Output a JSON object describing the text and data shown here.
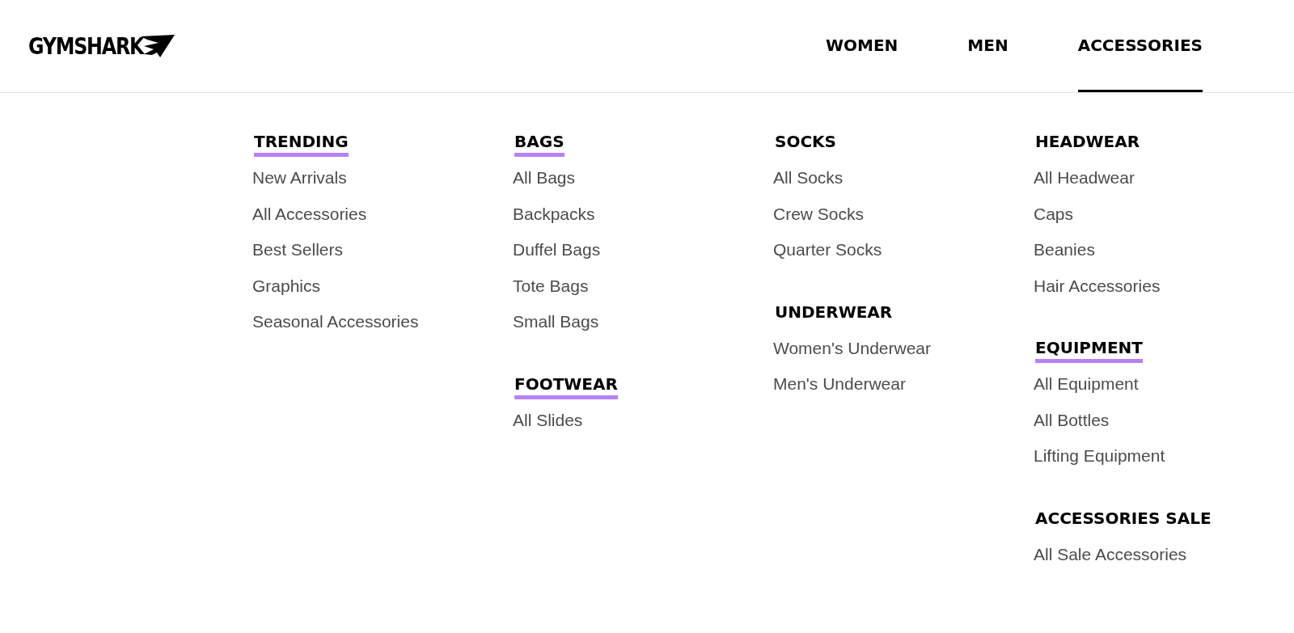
{
  "logo": {
    "text": "GYMSHARK"
  },
  "nav": [
    {
      "label": "WOMEN",
      "selected": false
    },
    {
      "label": "MEN",
      "selected": false
    },
    {
      "label": "ACCESSORIES",
      "selected": true
    }
  ],
  "menu": {
    "columns": [
      [
        {
          "heading": "TRENDING",
          "highlighted": true,
          "links": [
            "New Arrivals",
            "All Accessories",
            "Best Sellers",
            "Graphics",
            "Seasonal Accessories"
          ]
        }
      ],
      [
        {
          "heading": "BAGS",
          "highlighted": true,
          "links": [
            "All Bags",
            "Backpacks",
            "Duffel Bags",
            "Tote Bags",
            "Small Bags"
          ]
        },
        {
          "heading": "FOOTWEAR",
          "highlighted": true,
          "links": [
            "All Slides"
          ]
        }
      ],
      [
        {
          "heading": "SOCKS",
          "highlighted": false,
          "links": [
            "All Socks",
            "Crew Socks",
            "Quarter Socks"
          ]
        },
        {
          "heading": "UNDERWEAR",
          "highlighted": false,
          "links": [
            "Women's Underwear",
            "Men's Underwear"
          ]
        }
      ],
      [
        {
          "heading": "HEADWEAR",
          "highlighted": false,
          "links": [
            "All Headwear",
            "Caps",
            "Beanies",
            "Hair Accessories"
          ]
        },
        {
          "heading": "EQUIPMENT",
          "highlighted": true,
          "links": [
            "All Equipment",
            "All Bottles",
            "Lifting Equipment"
          ]
        },
        {
          "heading": "ACCESSORIES SALE",
          "highlighted": false,
          "links": [
            "All Sale Accessories"
          ]
        }
      ]
    ]
  }
}
